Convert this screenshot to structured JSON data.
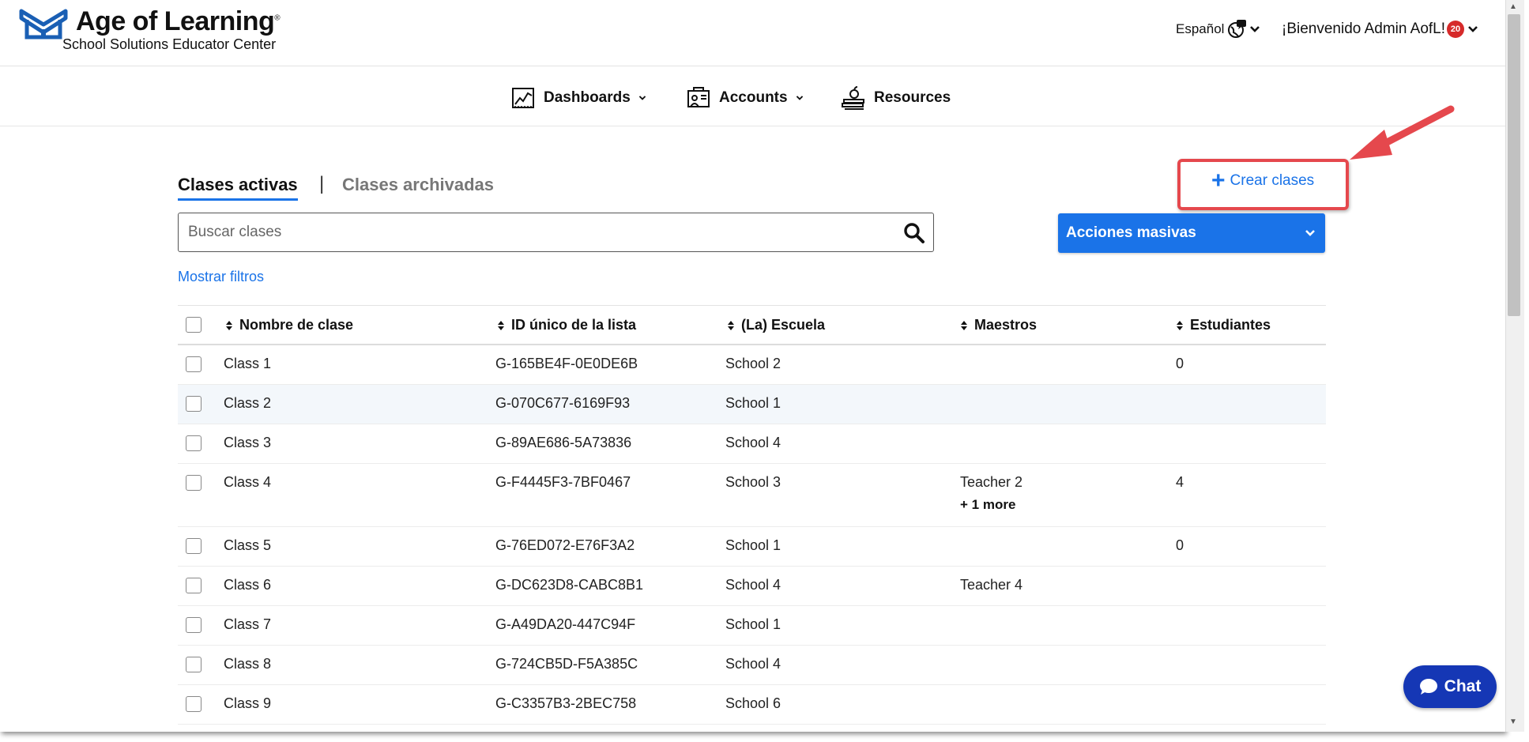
{
  "header": {
    "brand": "Age of Learning",
    "brand_mark": "®",
    "subtitle": "School Solutions Educator Center",
    "language": "Español",
    "welcome": "¡Bienvenido Admin AofL!",
    "notification_count": "20"
  },
  "nav": {
    "items": [
      {
        "label": "Dashboards",
        "icon": "chart-line-icon"
      },
      {
        "label": "Accounts",
        "icon": "account-board-icon"
      },
      {
        "label": "Resources",
        "icon": "books-apple-icon"
      }
    ]
  },
  "tabs": {
    "active": "Clases activas",
    "separator": "|",
    "inactive": "Clases archivadas"
  },
  "actions": {
    "create": "Crear clases",
    "bulk": "Acciones masivas",
    "show_filters": "Mostrar filtros"
  },
  "search": {
    "placeholder": "Buscar clases",
    "value": ""
  },
  "table": {
    "columns": [
      "Nombre de clase",
      "ID único de la lista",
      "(La) Escuela",
      "Maestros",
      "Estudiantes"
    ],
    "rows": [
      {
        "name": "Class 1",
        "id": "G-165BE4F-0E0DE6B",
        "school": "School 2",
        "teachers": "",
        "more": "",
        "students": "0"
      },
      {
        "name": "Class 2",
        "id": "G-070C677-6169F93",
        "school": "School 1",
        "teachers": "",
        "more": "",
        "students": ""
      },
      {
        "name": "Class 3",
        "id": "G-89AE686-5A73836",
        "school": "School 4",
        "teachers": "",
        "more": "",
        "students": ""
      },
      {
        "name": "Class 4",
        "id": "G-F4445F3-7BF0467",
        "school": "School 3",
        "teachers": "Teacher 2",
        "more": "+ 1 more",
        "students": "4"
      },
      {
        "name": "Class 5",
        "id": "G-76ED072-E76F3A2",
        "school": "School 1",
        "teachers": "",
        "more": "",
        "students": "0"
      },
      {
        "name": "Class 6",
        "id": "G-DC623D8-CABC8B1",
        "school": "School 4",
        "teachers": "Teacher 4",
        "more": "",
        "students": ""
      },
      {
        "name": "Class 7",
        "id": "G-A49DA20-447C94F",
        "school": "School 1",
        "teachers": "",
        "more": "",
        "students": ""
      },
      {
        "name": "Class 8",
        "id": "G-724CB5D-F5A385C",
        "school": "School 4",
        "teachers": "",
        "more": "",
        "students": ""
      },
      {
        "name": "Class 9",
        "id": "G-C3357B3-2BEC758",
        "school": "School 6",
        "teachers": "",
        "more": "",
        "students": ""
      }
    ]
  },
  "chat": {
    "label": "Chat"
  },
  "colors": {
    "accent": "#1a73e8",
    "highlight": "#e5484d",
    "chat": "#1537b5",
    "badge": "#d62a2a"
  }
}
